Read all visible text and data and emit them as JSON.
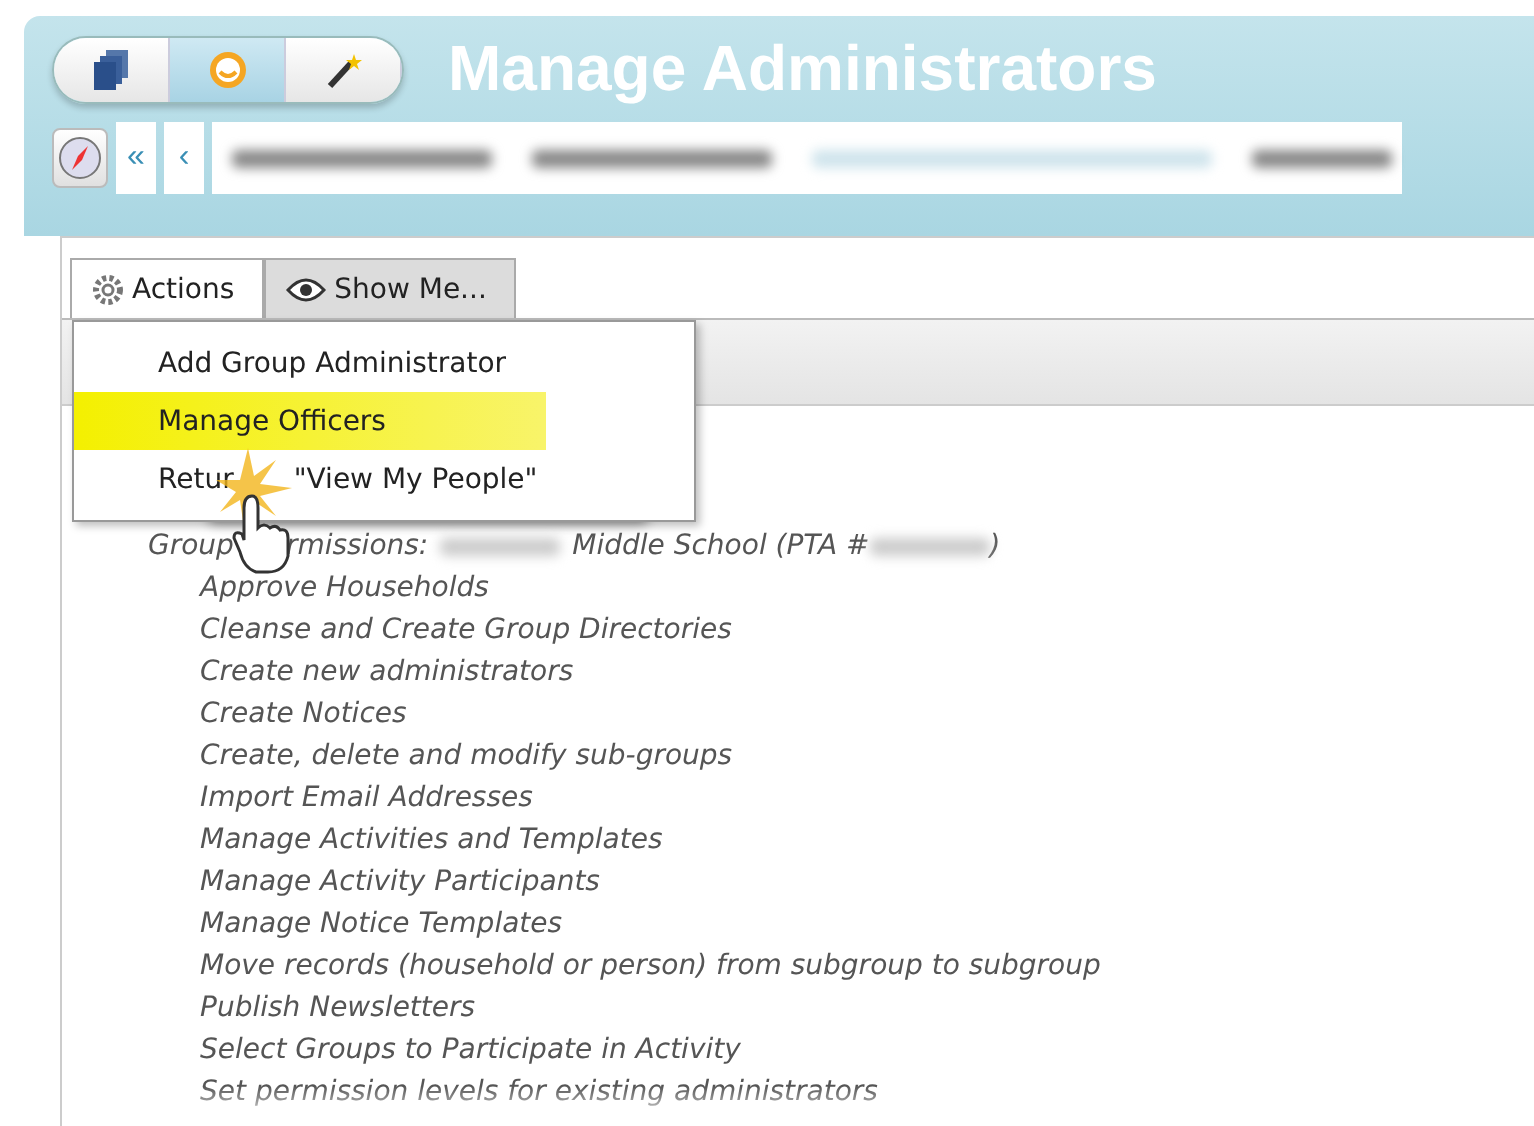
{
  "toolbar": {
    "buttons": [
      {
        "kind": "pages",
        "selected": false
      },
      {
        "kind": "face",
        "selected": true
      },
      {
        "kind": "wand",
        "selected": false
      }
    ]
  },
  "title": "Manage Administrators",
  "breadcrumb": {
    "nav": [
      "«",
      "‹"
    ]
  },
  "tabs": [
    {
      "label": "Actions",
      "selected": true
    },
    {
      "label": "Show Me...",
      "selected": false
    }
  ],
  "menu": {
    "items": [
      {
        "label": "Add Group Administrator",
        "highlighted": false
      },
      {
        "label": "Manage Officers",
        "highlighted": true
      },
      {
        "label": "Retur",
        "label_after": "\"View My People\"",
        "highlighted": false
      }
    ]
  },
  "permissions": {
    "label": "Group",
    "label_after": "rmissions:",
    "group": "Middle School (PTA #",
    "close": ")",
    "items": [
      "Approve Households",
      "Cleanse and Create Group Directories",
      "Create new administrators",
      "Create Notices",
      "Create, delete and modify sub-groups",
      "Import Email Addresses",
      "Manage Activities and Templates",
      "Manage Activity Participants",
      "Manage Notice Templates",
      "Move records (household or person) from subgroup to subgroup",
      "Publish Newsletters",
      "Select Groups to Participate in Activity",
      "Set permission levels for existing administrators"
    ]
  }
}
